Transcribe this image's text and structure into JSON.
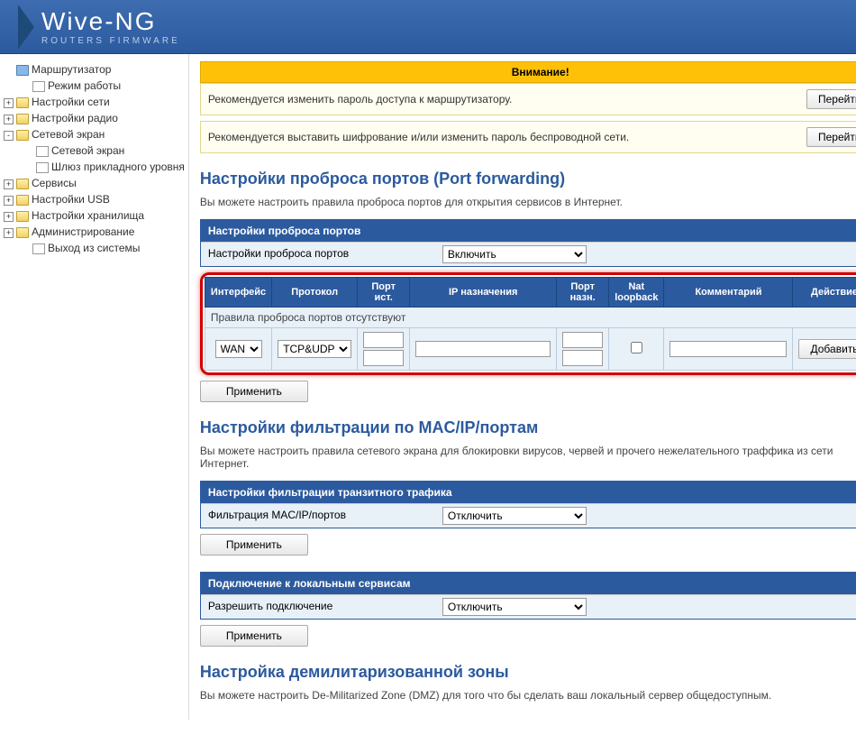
{
  "header": {
    "brand": "Wive-NG",
    "subtitle": "ROUTERS FIRMWARE"
  },
  "sidebar": {
    "items": [
      {
        "icon": "monitor",
        "label": "Маршрутизатор",
        "indent": 0,
        "expand": ""
      },
      {
        "icon": "page",
        "label": "Режим работы",
        "indent": 1,
        "expand": ""
      },
      {
        "icon": "folder",
        "label": "Настройки сети",
        "indent": 0,
        "expand": "+"
      },
      {
        "icon": "folder",
        "label": "Настройки радио",
        "indent": 0,
        "expand": "+"
      },
      {
        "icon": "folder-open",
        "label": "Сетевой экран",
        "indent": 0,
        "expand": "-"
      },
      {
        "icon": "page",
        "label": "Сетевой экран",
        "indent": 2,
        "expand": ""
      },
      {
        "icon": "page",
        "label": "Шлюз прикладного уровня",
        "indent": 2,
        "expand": ""
      },
      {
        "icon": "folder",
        "label": "Сервисы",
        "indent": 0,
        "expand": "+"
      },
      {
        "icon": "folder",
        "label": "Настройки USB",
        "indent": 0,
        "expand": "+"
      },
      {
        "icon": "folder",
        "label": "Настройки хранилища",
        "indent": 0,
        "expand": "+"
      },
      {
        "icon": "folder",
        "label": "Администрирование",
        "indent": 0,
        "expand": "+"
      },
      {
        "icon": "page",
        "label": "Выход из системы",
        "indent": 1,
        "expand": ""
      }
    ]
  },
  "attention": {
    "title": "Внимание!",
    "notice1": "Рекомендуется изменить пароль доступа к маршрутизатору.",
    "notice2": "Рекомендуется выставить шифрование и/или изменить пароль беспроводной сети.",
    "go": "Перейти"
  },
  "port_forward": {
    "title": "Настройки проброса портов (Port forwarding)",
    "intro": "Вы можете настроить правила проброса портов для открытия сервисов в Интернет.",
    "panel_header": "Настройки проброса портов",
    "row_label": "Настройки проброса портов",
    "row_value": "Включить",
    "cols": {
      "iface": "Интерфейс",
      "proto": "Протокол",
      "sport": "Порт ист.",
      "ip": "IP назначения",
      "dport": "Порт назн.",
      "nat": "Nat loopback",
      "comment": "Комментарий",
      "action": "Действие"
    },
    "empty": "Правила проброса портов отсутствуют",
    "iface_sel": "WAN",
    "proto_sel": "TCP&UDP",
    "add": "Добавить",
    "apply": "Применить"
  },
  "mac_filter": {
    "title": "Настройки фильтрации по MAC/IP/портам",
    "intro": "Вы можете настроить правила сетевого экрана для блокировки вирусов, червей и прочего нежелательного траффика из сети Интернет.",
    "panel_header": "Настройки фильтрации транзитного трафика",
    "row_label": "Фильтрация MAC/IP/портов",
    "row_value": "Отключить",
    "apply": "Применить"
  },
  "local_services": {
    "panel_header": "Подключение к локальным сервисам",
    "row_label": "Разрешить подключение",
    "row_value": "Отключить",
    "apply": "Применить"
  },
  "dmz": {
    "title": "Настройка демилитаризованной зоны",
    "intro": "Вы можете настроить De-Militarized Zone (DMZ) для того что бы сделать ваш локальный сервер общедоступным."
  }
}
